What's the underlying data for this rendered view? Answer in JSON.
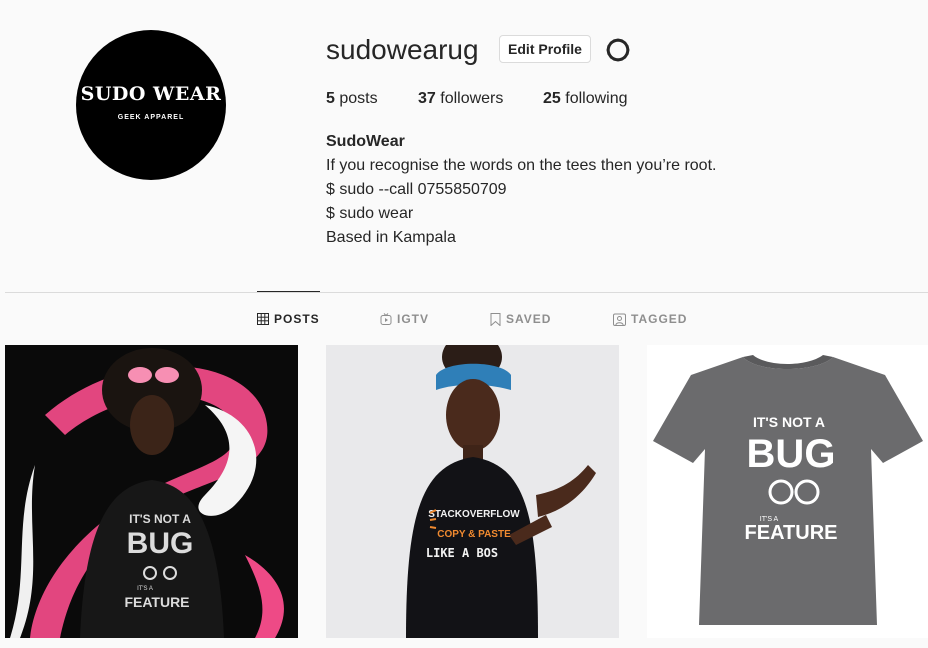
{
  "profile": {
    "avatar_brand": "SUDO WEAR",
    "avatar_tagline": "GEEK APPAREL",
    "username": "sudowearug",
    "edit_profile_label": "Edit Profile",
    "stats": {
      "posts_count": "5",
      "posts_label": "posts",
      "followers_count": "37",
      "followers_label": "followers",
      "following_count": "25",
      "following_label": "following"
    },
    "bio": {
      "name": "SudoWear",
      "lines": [
        "If you recognise the words on the tees then you’re root.",
        "$ sudo --call 0755850709",
        "$ sudo wear",
        "Based in Kampala"
      ]
    }
  },
  "tabs": [
    {
      "label": "POSTS",
      "icon": "grid-icon",
      "active": true
    },
    {
      "label": "IGTV",
      "icon": "igtv-icon",
      "active": false
    },
    {
      "label": "SAVED",
      "icon": "bookmark-icon",
      "active": false
    },
    {
      "label": "TAGGED",
      "icon": "tag-person-icon",
      "active": false
    }
  ],
  "posts": [
    {
      "shirt_text": [
        "IT'S NOT A",
        "BUG",
        "IT'S A",
        "FEATURE"
      ],
      "scene": "man in black tee with pink paint splash on black background"
    },
    {
      "shirt_text": [
        "STACKOVERFLOW",
        "COPY & PASTE",
        "LIKE A BOS"
      ],
      "scene": "woman in black tee pointing at shirt"
    },
    {
      "shirt_text": [
        "IT'S NOT A",
        "BUG",
        "IT'S A",
        "FEATURE"
      ],
      "scene": "grey tee product shot on white"
    }
  ],
  "colors": {
    "background": "#fafafa",
    "text": "#262626",
    "muted": "#8e8e8e",
    "border": "#dbdbdb",
    "accent_pink": "#ee4a86"
  }
}
